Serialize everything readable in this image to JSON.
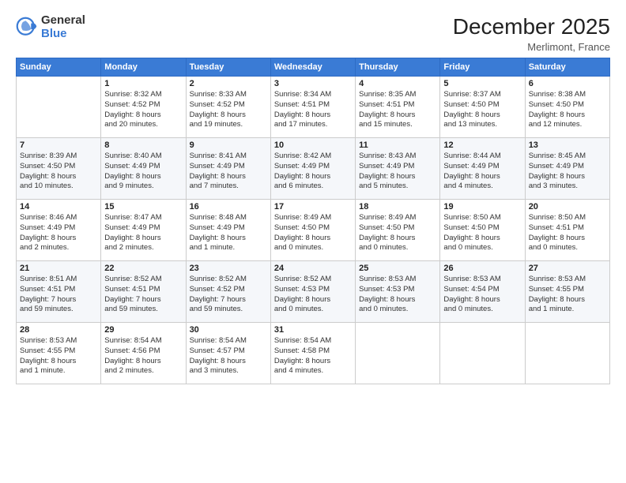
{
  "header": {
    "logo_general": "General",
    "logo_blue": "Blue",
    "month_title": "December 2025",
    "location": "Merlimont, France"
  },
  "days_of_week": [
    "Sunday",
    "Monday",
    "Tuesday",
    "Wednesday",
    "Thursday",
    "Friday",
    "Saturday"
  ],
  "weeks": [
    [
      {
        "day": "",
        "info": ""
      },
      {
        "day": "1",
        "info": "Sunrise: 8:32 AM\nSunset: 4:52 PM\nDaylight: 8 hours\nand 20 minutes."
      },
      {
        "day": "2",
        "info": "Sunrise: 8:33 AM\nSunset: 4:52 PM\nDaylight: 8 hours\nand 19 minutes."
      },
      {
        "day": "3",
        "info": "Sunrise: 8:34 AM\nSunset: 4:51 PM\nDaylight: 8 hours\nand 17 minutes."
      },
      {
        "day": "4",
        "info": "Sunrise: 8:35 AM\nSunset: 4:51 PM\nDaylight: 8 hours\nand 15 minutes."
      },
      {
        "day": "5",
        "info": "Sunrise: 8:37 AM\nSunset: 4:50 PM\nDaylight: 8 hours\nand 13 minutes."
      },
      {
        "day": "6",
        "info": "Sunrise: 8:38 AM\nSunset: 4:50 PM\nDaylight: 8 hours\nand 12 minutes."
      }
    ],
    [
      {
        "day": "7",
        "info": "Sunrise: 8:39 AM\nSunset: 4:50 PM\nDaylight: 8 hours\nand 10 minutes."
      },
      {
        "day": "8",
        "info": "Sunrise: 8:40 AM\nSunset: 4:49 PM\nDaylight: 8 hours\nand 9 minutes."
      },
      {
        "day": "9",
        "info": "Sunrise: 8:41 AM\nSunset: 4:49 PM\nDaylight: 8 hours\nand 7 minutes."
      },
      {
        "day": "10",
        "info": "Sunrise: 8:42 AM\nSunset: 4:49 PM\nDaylight: 8 hours\nand 6 minutes."
      },
      {
        "day": "11",
        "info": "Sunrise: 8:43 AM\nSunset: 4:49 PM\nDaylight: 8 hours\nand 5 minutes."
      },
      {
        "day": "12",
        "info": "Sunrise: 8:44 AM\nSunset: 4:49 PM\nDaylight: 8 hours\nand 4 minutes."
      },
      {
        "day": "13",
        "info": "Sunrise: 8:45 AM\nSunset: 4:49 PM\nDaylight: 8 hours\nand 3 minutes."
      }
    ],
    [
      {
        "day": "14",
        "info": "Sunrise: 8:46 AM\nSunset: 4:49 PM\nDaylight: 8 hours\nand 2 minutes."
      },
      {
        "day": "15",
        "info": "Sunrise: 8:47 AM\nSunset: 4:49 PM\nDaylight: 8 hours\nand 2 minutes."
      },
      {
        "day": "16",
        "info": "Sunrise: 8:48 AM\nSunset: 4:49 PM\nDaylight: 8 hours\nand 1 minute."
      },
      {
        "day": "17",
        "info": "Sunrise: 8:49 AM\nSunset: 4:50 PM\nDaylight: 8 hours\nand 0 minutes."
      },
      {
        "day": "18",
        "info": "Sunrise: 8:49 AM\nSunset: 4:50 PM\nDaylight: 8 hours\nand 0 minutes."
      },
      {
        "day": "19",
        "info": "Sunrise: 8:50 AM\nSunset: 4:50 PM\nDaylight: 8 hours\nand 0 minutes."
      },
      {
        "day": "20",
        "info": "Sunrise: 8:50 AM\nSunset: 4:51 PM\nDaylight: 8 hours\nand 0 minutes."
      }
    ],
    [
      {
        "day": "21",
        "info": "Sunrise: 8:51 AM\nSunset: 4:51 PM\nDaylight: 7 hours\nand 59 minutes."
      },
      {
        "day": "22",
        "info": "Sunrise: 8:52 AM\nSunset: 4:51 PM\nDaylight: 7 hours\nand 59 minutes."
      },
      {
        "day": "23",
        "info": "Sunrise: 8:52 AM\nSunset: 4:52 PM\nDaylight: 7 hours\nand 59 minutes."
      },
      {
        "day": "24",
        "info": "Sunrise: 8:52 AM\nSunset: 4:53 PM\nDaylight: 8 hours\nand 0 minutes."
      },
      {
        "day": "25",
        "info": "Sunrise: 8:53 AM\nSunset: 4:53 PM\nDaylight: 8 hours\nand 0 minutes."
      },
      {
        "day": "26",
        "info": "Sunrise: 8:53 AM\nSunset: 4:54 PM\nDaylight: 8 hours\nand 0 minutes."
      },
      {
        "day": "27",
        "info": "Sunrise: 8:53 AM\nSunset: 4:55 PM\nDaylight: 8 hours\nand 1 minute."
      }
    ],
    [
      {
        "day": "28",
        "info": "Sunrise: 8:53 AM\nSunset: 4:55 PM\nDaylight: 8 hours\nand 1 minute."
      },
      {
        "day": "29",
        "info": "Sunrise: 8:54 AM\nSunset: 4:56 PM\nDaylight: 8 hours\nand 2 minutes."
      },
      {
        "day": "30",
        "info": "Sunrise: 8:54 AM\nSunset: 4:57 PM\nDaylight: 8 hours\nand 3 minutes."
      },
      {
        "day": "31",
        "info": "Sunrise: 8:54 AM\nSunset: 4:58 PM\nDaylight: 8 hours\nand 4 minutes."
      },
      {
        "day": "",
        "info": ""
      },
      {
        "day": "",
        "info": ""
      },
      {
        "day": "",
        "info": ""
      }
    ]
  ]
}
